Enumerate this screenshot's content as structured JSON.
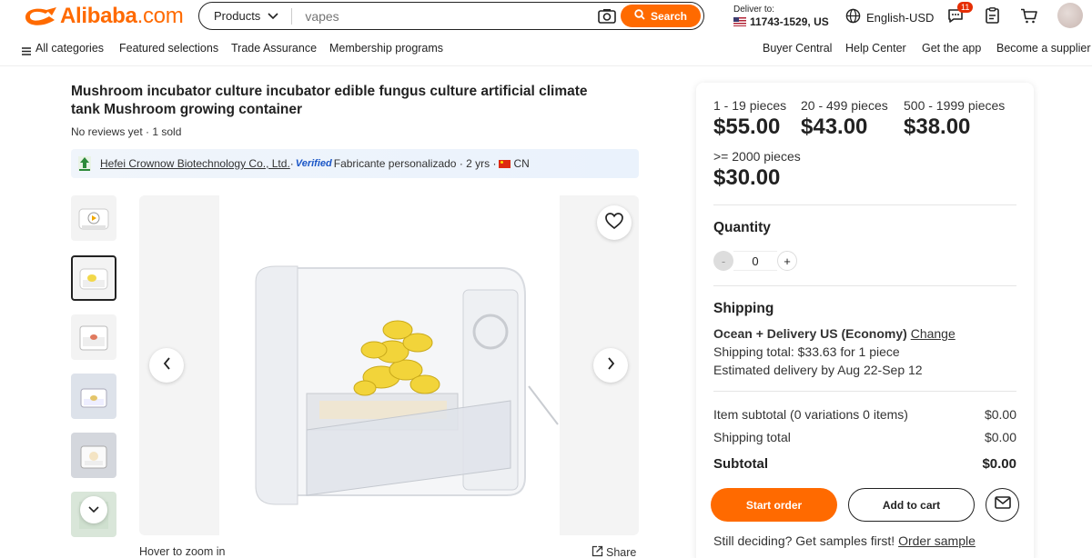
{
  "header": {
    "logo_text": "Alibaba",
    "logo_suffix": ".com",
    "search": {
      "category": "Products",
      "placeholder": "vapes",
      "button": "Search"
    },
    "deliver_label": "Deliver to:",
    "deliver_zip": "11743-1529, US",
    "language": "English-USD",
    "message_badge": "11"
  },
  "nav": {
    "left": [
      "All categories",
      "Featured selections",
      "Trade Assurance",
      "Membership programs"
    ],
    "right": [
      "Buyer Central",
      "Help Center",
      "Get the app",
      "Become a supplier"
    ]
  },
  "product": {
    "title": "Mushroom incubator culture incubator edible fungus culture artificial climate tank Mushroom growing container",
    "meta": "No reviews yet · 1 sold",
    "supplier_name": "Hefei Crownow Biotechnology Co., Ltd.",
    "supplier_sep": " · ",
    "verified": "Verified",
    "supplier_type": "Fabricante personalizado · 2 yrs · ",
    "supplier_country": "CN",
    "hover_text": "Hover to zoom in",
    "share": "Share"
  },
  "price_tiers": [
    {
      "range": "1 - 19 pieces",
      "price": "$55.00"
    },
    {
      "range": "20 - 499 pieces",
      "price": "$43.00"
    },
    {
      "range": "500 - 1999 pieces",
      "price": "$38.00"
    },
    {
      "range": ">= 2000 pieces",
      "price": "$30.00"
    }
  ],
  "quantity": {
    "label": "Quantity",
    "value": "0",
    "minus": "-",
    "plus": "+"
  },
  "shipping": {
    "label": "Shipping",
    "method": "Ocean + Delivery US (Economy)",
    "change": "Change",
    "total": "Shipping total: $33.63 for 1 piece",
    "eta": "Estimated delivery by Aug 22-Sep 12"
  },
  "summary": {
    "item_label": "Item subtotal (0 variations 0 items)",
    "item_value": "$0.00",
    "ship_label": "Shipping total",
    "ship_value": "$0.00",
    "subtotal_label": "Subtotal",
    "subtotal_value": "$0.00"
  },
  "actions": {
    "start_order": "Start order",
    "add_to_cart": "Add to cart"
  },
  "samples": {
    "text": "Still deciding? Get samples first! ",
    "link": "Order sample"
  },
  "colors": {
    "accent": "#ff6a00",
    "verified": "#1a56c7"
  }
}
